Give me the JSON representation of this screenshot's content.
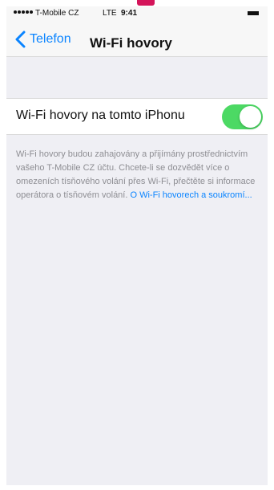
{
  "status_bar": {
    "carrier": "T-Mobile CZ",
    "network": "LTE",
    "time": "9:41"
  },
  "navigation": {
    "back_label": "Telefon",
    "title": "Wi-Fi hovory"
  },
  "wifi_calling": {
    "label": "Wi-Fi hovory na tomto iPhonu",
    "enabled": true,
    "toggle_color": "#4cd964"
  },
  "description": {
    "text": "Wi-Fi hovory budou zahajovány a přijímány prostřednictvím vašeho T-Mobile CZ účtu. Chcete-li se dozvědět více o omezeních tísňového volání přes Wi-Fi, přečtěte si informace operátora o tísňovém volání.",
    "link_text": "O Wi-Fi hovorech a soukromí..."
  },
  "icons": {
    "back": "chevron-left-icon",
    "battery": "battery-icon",
    "signal": "signal-dots-icon"
  },
  "colors": {
    "accent": "#0a84ff",
    "background": "#efeff4",
    "toggle_on": "#4cd964"
  }
}
